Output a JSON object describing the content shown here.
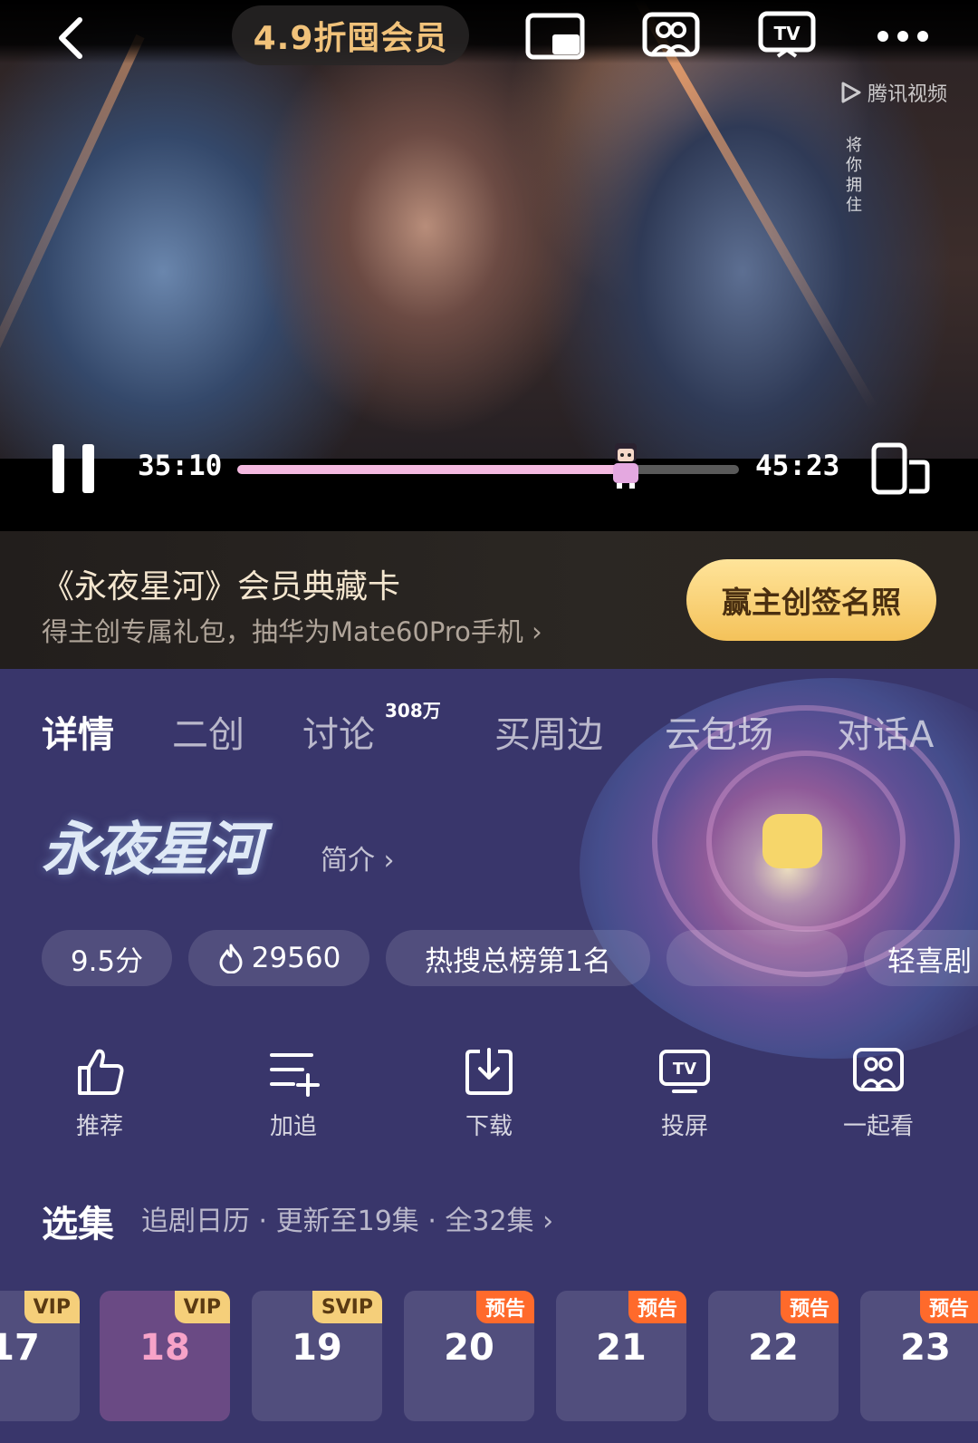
{
  "player": {
    "promo_label": "4.9折囤会员",
    "watermark": "腾讯视频",
    "vertical_text": "将你拥住",
    "current_time": "35:10",
    "total_time": "45:23",
    "progress": 0.775
  },
  "banner": {
    "title": "《永夜星河》会员典藏卡",
    "subtitle": "得主创专属礼包，抽华为Mate60Pro手机 ›",
    "button_label": "赢主创签名照"
  },
  "tabs": [
    {
      "label": "详情"
    },
    {
      "label": "二创"
    },
    {
      "label": "讨论",
      "badge": "308万"
    },
    {
      "label": "买周边"
    },
    {
      "label": "云包场"
    },
    {
      "label": "对话A"
    }
  ],
  "show": {
    "title_logo": "永夜星河",
    "intro_link": "简介 ›"
  },
  "chips": [
    {
      "label": "9.5分"
    },
    {
      "label": "29560",
      "icon": "flame-icon"
    },
    {
      "label": "热搜总榜第1名"
    },
    {
      "label": ""
    },
    {
      "label": "轻喜剧"
    }
  ],
  "actions": [
    {
      "label": "推荐",
      "icon": "thumbs-up-icon"
    },
    {
      "label": "加追",
      "icon": "add-list-icon"
    },
    {
      "label": "下载",
      "icon": "download-icon"
    },
    {
      "label": "投屏",
      "icon": "tv-cast-icon"
    },
    {
      "label": "一起看",
      "icon": "watch-together-icon"
    }
  ],
  "episodes": {
    "title": "选集",
    "meta": "追剧日历 · 更新至19集 · 全32集 ›",
    "items": [
      {
        "num": "17",
        "tag": "VIP"
      },
      {
        "num": "18",
        "tag": "VIP",
        "current": true
      },
      {
        "num": "19",
        "tag": "SVIP"
      },
      {
        "num": "20",
        "tag": "预告"
      },
      {
        "num": "21",
        "tag": "预告"
      },
      {
        "num": "22",
        "tag": "预告"
      },
      {
        "num": "23",
        "tag": "预告"
      }
    ]
  },
  "colors": {
    "panel_bg": "#39366b",
    "accent_gold": "#f4c25a",
    "progress_fill": "#f4b9e0",
    "preview_tag": "#ff6a2b"
  }
}
